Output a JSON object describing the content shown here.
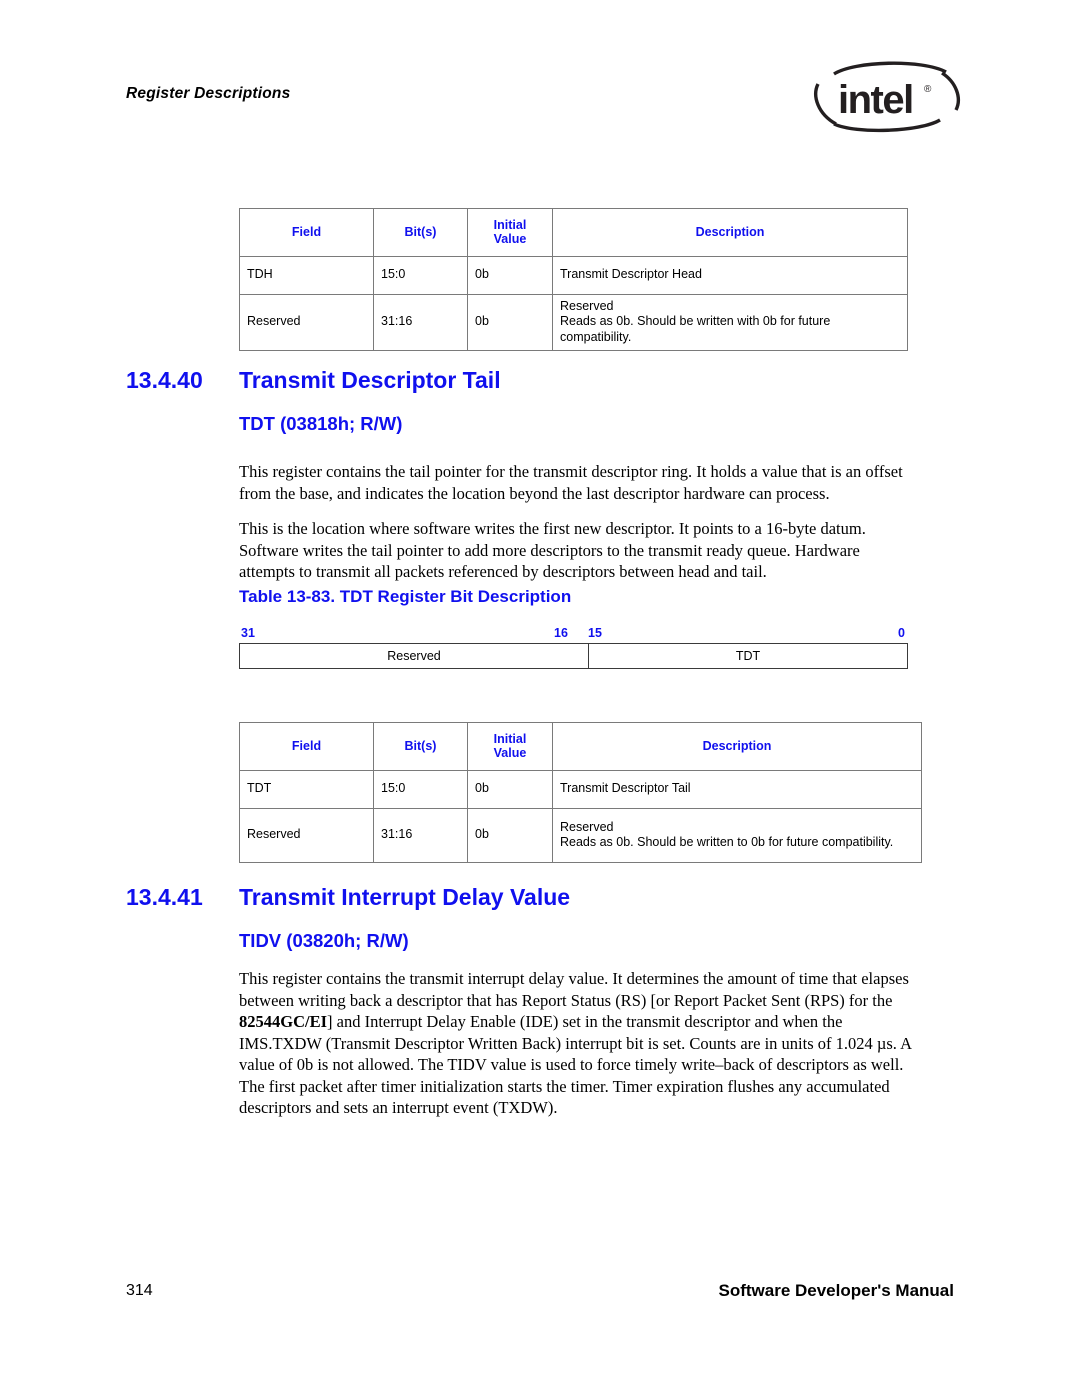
{
  "header": {
    "running_header": "Register Descriptions",
    "logo": {
      "name": "intel-logo",
      "wordmark": "intel",
      "registered_mark": "®"
    }
  },
  "tables": {
    "columns": [
      "Field",
      "Bit(s)",
      "Initial Value",
      "Description"
    ],
    "column_labels": {
      "field": "Field",
      "bits": "Bit(s)",
      "initial_line1": "Initial",
      "initial_line2": "Value",
      "description": "Description"
    },
    "tdh_table": {
      "rows": [
        {
          "field": "TDH",
          "bits": "15:0",
          "initial": "0b",
          "description_lines": [
            "Transmit Descriptor Head"
          ]
        },
        {
          "field": "Reserved",
          "bits": "31:16",
          "initial": "0b",
          "description_lines": [
            "Reserved",
            "Reads as 0b. Should be written with 0b for future compatibility."
          ]
        }
      ]
    },
    "tdt_table": {
      "rows": [
        {
          "field": "TDT",
          "bits": "15:0",
          "initial": "0b",
          "description_lines": [
            "Transmit Descriptor Tail"
          ]
        },
        {
          "field": "Reserved",
          "bits": "31:16",
          "initial": "0b",
          "description_lines": [
            "Reserved",
            "Reads as 0b. Should be written to 0b for future compatibility."
          ]
        }
      ]
    }
  },
  "section_13_4_40": {
    "number": "13.4.40",
    "title": "Transmit Descriptor Tail",
    "subtitle": "TDT (03818h; R/W)",
    "paragraph_1": "This register contains the tail pointer for the transmit descriptor ring. It holds a value that is an offset from the base, and indicates the location beyond the last descriptor hardware can process.",
    "paragraph_2": "This is the location where software writes the first new descriptor. It points to a 16-byte datum. Software writes the tail pointer to add more descriptors to the transmit ready queue. Hardware attempts to transmit all packets referenced by descriptors between head and tail.",
    "table_caption": "Table 13-83. TDT Register Bit Description",
    "bit_diagram": {
      "labels": {
        "msb": "31",
        "mid_high": "16",
        "mid_low": "15",
        "lsb": "0"
      },
      "fields": [
        {
          "name": "Reserved",
          "bits": "31:16"
        },
        {
          "name": "TDT",
          "bits": "15:0"
        }
      ]
    }
  },
  "section_13_4_41": {
    "number": "13.4.41",
    "title": "Transmit Interrupt Delay Value",
    "subtitle": "TIDV (03820h; R/W)",
    "paragraph_parts": {
      "part_1": "This register contains the transmit interrupt delay value. It determines the amount of time that elapses between writing back a descriptor that has Report Status (RS) [or Report Packet Sent (RPS) for the ",
      "bold_1": "82544GC/EI",
      "part_2": "] and Interrupt Delay Enable (IDE) set in the transmit descriptor and when the IMS.TXDW (Transmit Descriptor Written Back) interrupt bit is set. Counts are in units of 1.024 µs. A value of 0b is not allowed. The TIDV value is used to force timely write–back of descriptors as well. The first packet after timer initialization starts the timer. Timer expiration flushes any accumulated descriptors and sets an interrupt event (TXDW)."
    }
  },
  "footer": {
    "page_number": "314",
    "manual_title": "Software Developer's Manual"
  },
  "colors": {
    "heading_blue": "#1010ee",
    "text_black": "#000000",
    "table_border": "#7a7a7a",
    "page_background": "#ffffff"
  }
}
